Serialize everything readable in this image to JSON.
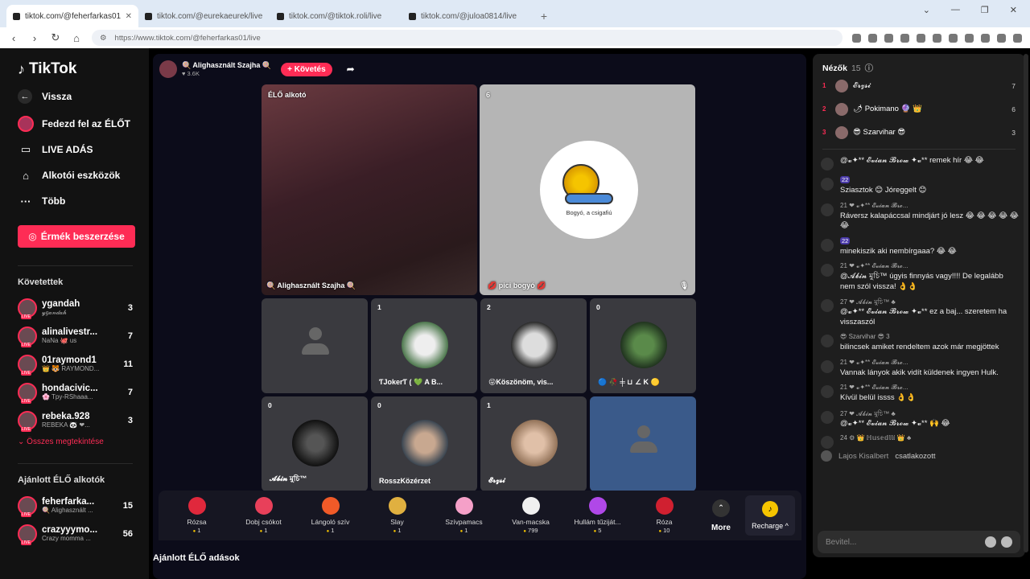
{
  "browser": {
    "tabs": [
      {
        "title": "tiktok.com/@feherfarkas01/li..."
      },
      {
        "title": "tiktok.com/@eurekaeurek/live"
      },
      {
        "title": "tiktok.com/@tiktok.roli/live"
      },
      {
        "title": "tiktok.com/@juloa0814/live"
      }
    ],
    "new_tab": "+",
    "url": "https://www.tiktok.com/@feherfarkas01/live"
  },
  "sidebar": {
    "logo": "TikTok",
    "back": "Vissza",
    "menu": [
      {
        "label": "Fedezd fel az ÉLŐT"
      },
      {
        "label": "LIVE ADÁS"
      },
      {
        "label": "Alkotói eszközök"
      },
      {
        "label": "Több"
      }
    ],
    "coins_button": "Érmék beszerzése",
    "following_title": "Követettek",
    "following": [
      {
        "name": "ygandah",
        "sub": "𝓎𝑔𝒶𝓃𝒹𝒶𝒽",
        "count": "3"
      },
      {
        "name": "alinalivestr...",
        "sub": "NaNa 🐙 us",
        "count": "7"
      },
      {
        "name": "01raymond1",
        "sub": "👑 🐯 RAYMOND...",
        "count": "11"
      },
      {
        "name": "hondacivic...",
        "sub": "🌸 Tpy-RShaaa...",
        "count": "7"
      },
      {
        "name": "rebeka.928",
        "sub": "REBEKA 🐼 ❤...",
        "count": "3"
      }
    ],
    "see_all": "Összes megtekintése",
    "suggested_title": "Ajánlott ÉLŐ alkotók",
    "suggested": [
      {
        "name": "feherfarka...",
        "sub": "🍭 Alighasznált ...",
        "count": "15"
      },
      {
        "name": "crazyyymo...",
        "sub": "Crazy momma ...",
        "count": "56"
      }
    ]
  },
  "stream": {
    "host_name": "🍭 Alighasznált Szajha 🍭",
    "host_likes": "♥ 3.6K",
    "follow_label": "+ Követés",
    "host_tile_label": "ÉLŐ alkotó",
    "host_tile_name": "🍭 Alighasznált Szajha 🍭",
    "cohost_count": "6",
    "cohost_name": "💋 pici bogyó 💋",
    "cohost_caption": "Bogyó, a csigafiú",
    "guests": [
      {
        "count": "",
        "name": ""
      },
      {
        "count": "1",
        "name": "ƬJokerƬ ( 💚 A B..."
      },
      {
        "count": "2",
        "name": "😜Köszönöm, vis..."
      },
      {
        "count": "0",
        "name": "🔵 🥀 ╪ ⊔ ∠ K 🟡"
      },
      {
        "count": "0",
        "name": "𝓐𝓫𝓲𝓷 মুচি™"
      },
      {
        "count": "0",
        "name": "RosszKözérzet"
      },
      {
        "count": "1",
        "name": "𝓔𝓻𝔃𝓼𝓲"
      },
      {
        "count": "",
        "name": ""
      }
    ],
    "below_title": "Ajánlott ÉLŐ adások"
  },
  "gifts": [
    {
      "name": "Rózsa",
      "price": "1",
      "color": "#e0283c"
    },
    {
      "name": "Dobj csókot",
      "price": "1",
      "color": "#e8405a"
    },
    {
      "name": "Lángoló szív",
      "price": "1",
      "color": "#f05a28"
    },
    {
      "name": "Slay",
      "price": "1",
      "color": "#e0b040"
    },
    {
      "name": "Szívpamacs",
      "price": "1",
      "color": "#f5a0c8"
    },
    {
      "name": "Van-macska",
      "price": "799",
      "color": "#f0f0f0"
    },
    {
      "name": "Hullám tűziját...",
      "price": "5",
      "color": "#b048e8"
    },
    {
      "name": "Róza",
      "price": "10",
      "color": "#d02030"
    }
  ],
  "more_label": "More",
  "recharge_label": "Recharge ^",
  "viewers": {
    "title": "Nézők",
    "count": "15",
    "list": [
      {
        "rank": "1",
        "name": "𝓔𝓻𝔃𝓼𝓲",
        "score": "7"
      },
      {
        "rank": "2",
        "name": "🌶 Pokimano 🔮 👑",
        "score": "6"
      },
      {
        "rank": "3",
        "name": "😎 Szarvihar 😎",
        "score": "3"
      }
    ]
  },
  "chat": [
    {
      "header": "",
      "text": "@𝓿✦** 𝓔𝓿𝓲𝓪𝓷 𝓑𝓻𝓸𝔀 ✦𝓿** remek hír 😂 😂"
    },
    {
      "header": "22",
      "text": "Sziasztok 😊 Jóreggelt 😊"
    },
    {
      "header": "21 ❤ 𝓿✦** 𝓔𝓿𝓲𝓪𝓷 𝓑𝓻𝓸...",
      "text": "Ráversz kalapáccsal mindjárt jó lesz 😂 😂 😂 😂 😂 😂"
    },
    {
      "header": "22",
      "text": "minekiszik aki nembírgaaa? 😂 😂"
    },
    {
      "header": "21 ❤ 𝓿✦** 𝓔𝓿𝓲𝓪𝓷 𝓑𝓻𝓸...",
      "text": "@𝓐𝓫𝓲𝓷 মুচি™ úgyis finnyás vagy!!!! De legalább nem szól vissza! 👌👌"
    },
    {
      "header": "27 ❤ 𝓐𝓫𝓲𝓷 মুচি™ ♣",
      "text": "@𝓿✦** 𝓔𝓿𝓲𝓪𝓷 𝓑𝓻𝓸𝔀 ✦𝓿** ez a baj... szeretem ha visszaszól"
    },
    {
      "header": "😎 Szarvihar 😎 3",
      "text": "bilincsek amiket rendeltem azok már megjöttek"
    },
    {
      "header": "21 ❤ 𝓿✦** 𝓔𝓿𝓲𝓪𝓷 𝓑𝓻𝓸...",
      "text": "Vannak lányok akik vidít küldenek ingyen Hulk."
    },
    {
      "header": "21 ❤ 𝓿✦** 𝓔𝓿𝓲𝓪𝓷 𝓑𝓻𝓸...",
      "text": "Kívül belül issss 👌👌"
    },
    {
      "header": "27 ❤ 𝓐𝓫𝓲𝓷 মুচি™ ♣",
      "text": "@𝓿✦** 𝓔𝓿𝓲𝓪𝓷 𝓑𝓻𝓸𝔀 ✦𝓿** 🙌 😂"
    },
    {
      "header": "24 ⚙ 👑 ℍ𝕦𝕤𝕖𝕕𝕝𝕝𝕚 👑 ♣",
      "text": ""
    }
  ],
  "join": {
    "name": "Lajos Kisalbert",
    "text": "csatlakozott"
  },
  "input_placeholder": "Bevitel..."
}
